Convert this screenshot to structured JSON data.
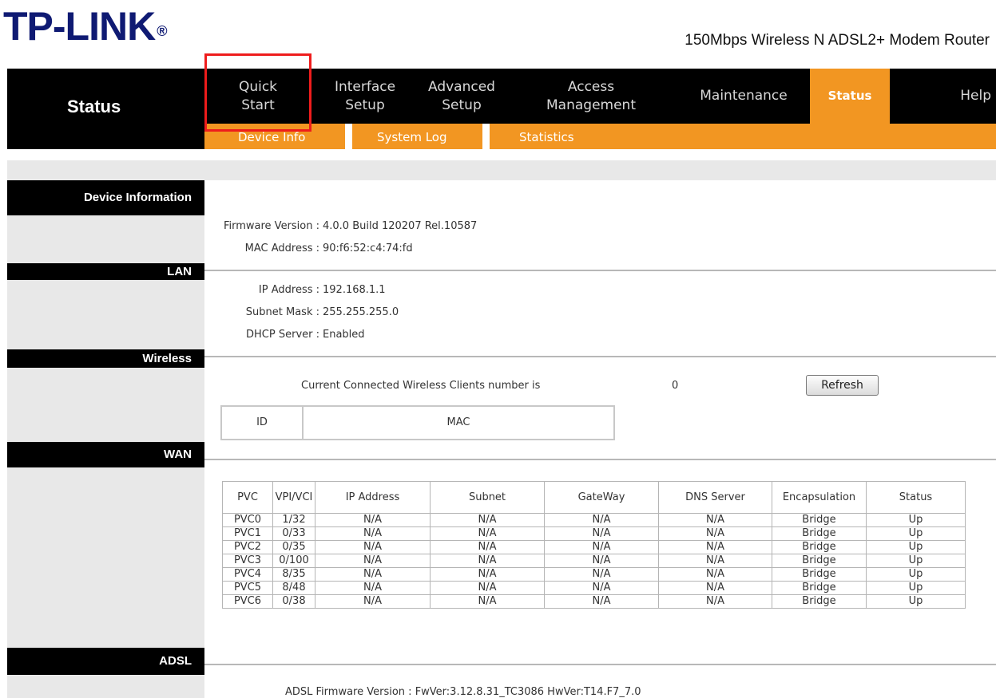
{
  "brand": {
    "logo": "TP-LINK",
    "reg": "®",
    "product": "150Mbps Wireless N ADSL2+ Modem Router"
  },
  "sidebar_title": "Status",
  "nav": [
    {
      "label": "Quick\nStart"
    },
    {
      "label": "Interface\nSetup"
    },
    {
      "label": "Advanced\nSetup"
    },
    {
      "label": "Access\nManagement"
    },
    {
      "label": "Maintenance"
    },
    {
      "label": "Status",
      "active": true
    },
    {
      "label": "Help"
    }
  ],
  "subnav": [
    "Device Info",
    "System Log",
    "Statistics"
  ],
  "sections": {
    "device": "Device Information",
    "lan": "LAN",
    "wireless": "Wireless",
    "wan": "WAN",
    "adsl": "ADSL"
  },
  "device_info": {
    "firmware_label": "Firmware Version :",
    "firmware_value": "4.0.0 Build 120207 Rel.10587",
    "mac_label": "MAC Address :",
    "mac_value": "90:f6:52:c4:74:fd"
  },
  "lan": {
    "ip_label": "IP Address :",
    "ip_value": "192.168.1.1",
    "mask_label": "Subnet Mask :",
    "mask_value": "255.255.255.0",
    "dhcp_label": "DHCP Server :",
    "dhcp_value": "Enabled"
  },
  "wireless": {
    "clients_text": "Current Connected Wireless Clients number is",
    "clients_count": "0",
    "refresh_label": "Refresh",
    "table_headers": [
      "ID",
      "MAC"
    ]
  },
  "wan": {
    "headers": [
      "PVC",
      "VPI/VCI",
      "IP Address",
      "Subnet",
      "GateWay",
      "DNS Server",
      "Encapsulation",
      "Status"
    ],
    "rows": [
      [
        "PVC0",
        "1/32",
        "N/A",
        "N/A",
        "N/A",
        "N/A",
        "Bridge",
        "Up"
      ],
      [
        "PVC1",
        "0/33",
        "N/A",
        "N/A",
        "N/A",
        "N/A",
        "Bridge",
        "Up"
      ],
      [
        "PVC2",
        "0/35",
        "N/A",
        "N/A",
        "N/A",
        "N/A",
        "Bridge",
        "Up"
      ],
      [
        "PVC3",
        "0/100",
        "N/A",
        "N/A",
        "N/A",
        "N/A",
        "Bridge",
        "Up"
      ],
      [
        "PVC4",
        "8/35",
        "N/A",
        "N/A",
        "N/A",
        "N/A",
        "Bridge",
        "Up"
      ],
      [
        "PVC5",
        "8/48",
        "N/A",
        "N/A",
        "N/A",
        "N/A",
        "Bridge",
        "Up"
      ],
      [
        "PVC6",
        "0/38",
        "N/A",
        "N/A",
        "N/A",
        "N/A",
        "Bridge",
        "Up"
      ]
    ]
  },
  "adsl": {
    "firmware_text": "ADSL Firmware Version : FwVer:3.12.8.31_TC3086 HwVer:T14.F7_7.0"
  },
  "colors": {
    "accent": "#f29622",
    "highlight": "#ee1c1c",
    "logo": "#0f1a73"
  }
}
